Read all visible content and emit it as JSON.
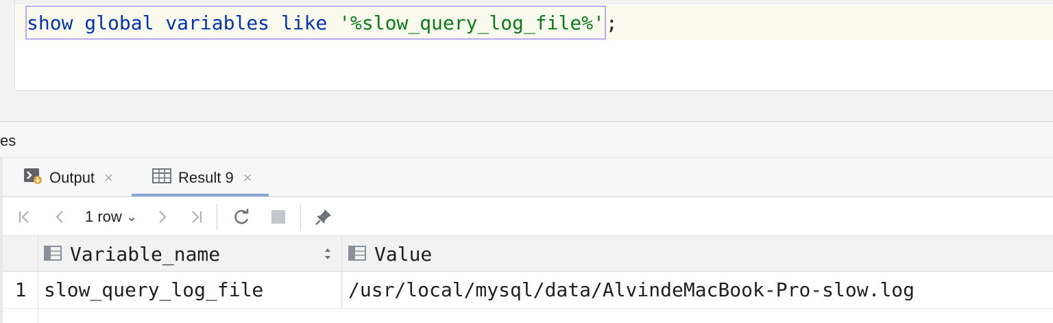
{
  "editor": {
    "tokens": [
      {
        "text": "show",
        "kind": "kw"
      },
      {
        "text": " ",
        "kind": "punct"
      },
      {
        "text": "global",
        "kind": "kw"
      },
      {
        "text": " ",
        "kind": "punct"
      },
      {
        "text": "variables",
        "kind": "kw"
      },
      {
        "text": " ",
        "kind": "punct"
      },
      {
        "text": "like",
        "kind": "kw"
      },
      {
        "text": " ",
        "kind": "punct"
      },
      {
        "text": "'%slow_query_log_file%'",
        "kind": "str"
      },
      {
        "text": ";",
        "kind": "punct"
      }
    ]
  },
  "services": {
    "label": "es"
  },
  "tabs": [
    {
      "label": "Output",
      "icon": "console-output-icon",
      "close": "×"
    },
    {
      "label": "Result 9",
      "icon": "table-icon",
      "close": "×"
    }
  ],
  "toolbar": {
    "rows_label": "1 row",
    "dropdown_glyph": "⌄",
    "icons": [
      "first-page-icon",
      "previous-page-icon",
      "next-page-icon",
      "last-page-icon",
      "refresh-icon",
      "stop-icon",
      "pin-icon"
    ]
  },
  "grid": {
    "columns": [
      "Variable_name",
      "Value"
    ],
    "rows": [
      {
        "num": "1",
        "cells": [
          "slow_query_log_file",
          "/usr/local/mysql/data/AlvindeMacBook-Pro-slow.log"
        ]
      }
    ]
  },
  "colors": {
    "keyword": "#0033b3",
    "string": "#067d17",
    "active_tab_underline": "#8aa4d6",
    "selection_border": "#b5a9f0"
  }
}
